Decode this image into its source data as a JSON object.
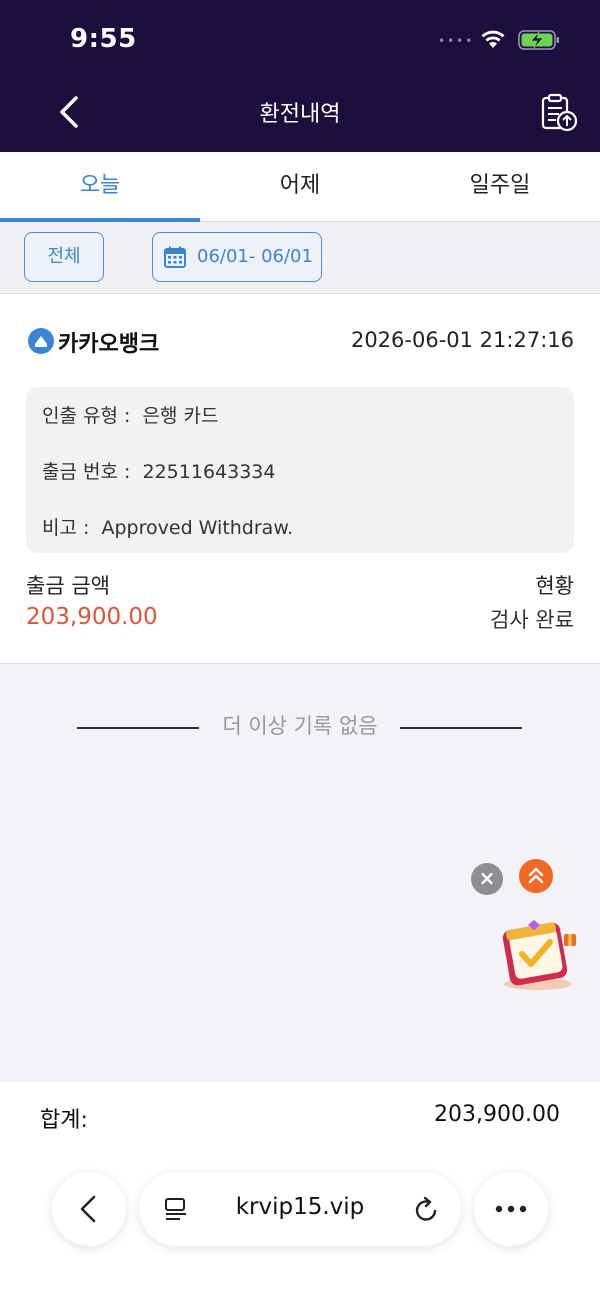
{
  "status_bar": {
    "time": "9:55",
    "signal_dots": "••••"
  },
  "header": {
    "title": "환전내역"
  },
  "tabs": [
    {
      "label": "오늘",
      "active": true
    },
    {
      "label": "어제",
      "active": false
    },
    {
      "label": "일주일",
      "active": false
    }
  ],
  "filters": {
    "all_label": "전체",
    "date_range": "06/01- 06/01"
  },
  "record": {
    "bank_name": "카카오뱅크",
    "timestamp": "2026-06-01 21:27:16",
    "details": {
      "type_label": "인출 유형 :",
      "type_value": "은행 카드",
      "number_label": "출금 번호 :",
      "number_value": "22511643334",
      "note_label": "비고 :",
      "note_value": "Approved Withdraw."
    },
    "amount_label": "출금 금액",
    "amount_value": "203,900.00",
    "status_label": "현황",
    "status_value": "검사 완료"
  },
  "no_more_text": "더 이상 기록 없음",
  "footer": {
    "total_label": "합계:",
    "total_value": "203,900.00"
  },
  "browser": {
    "url": "krvip15.vip"
  },
  "colors": {
    "header_bg": "#1c0f3d",
    "accent": "#3a86d4",
    "amount": "#e0553a"
  }
}
